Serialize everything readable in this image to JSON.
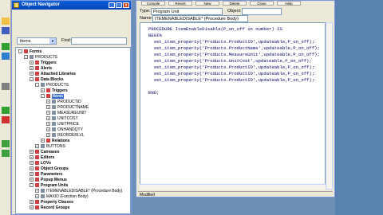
{
  "navigator": {
    "title": "Object Navigator",
    "view_select": "Items",
    "find_label": "Find:",
    "tree": [
      {
        "label": "Forms",
        "bold": true,
        "indent": 0,
        "expanded": true
      },
      {
        "label": "PRODUCTS",
        "bold": false,
        "indent": 1,
        "expanded": true
      },
      {
        "label": "Triggers",
        "bold": true,
        "indent": 2
      },
      {
        "label": "Alerts",
        "bold": true,
        "indent": 2
      },
      {
        "label": "Attached Libraries",
        "bold": true,
        "indent": 2
      },
      {
        "label": "Data Blocks",
        "bold": true,
        "indent": 2,
        "expanded": true
      },
      {
        "label": "PRODUCTS",
        "bold": false,
        "indent": 3,
        "expanded": true
      },
      {
        "label": "Triggers",
        "bold": true,
        "indent": 4
      },
      {
        "label": "Items",
        "bold": true,
        "indent": 4,
        "expanded": true,
        "selected": true
      },
      {
        "label": "PRODUCTID",
        "bold": false,
        "indent": 5
      },
      {
        "label": "PRODUCTNAME",
        "bold": false,
        "indent": 5
      },
      {
        "label": "MEASUREUNIT",
        "bold": false,
        "indent": 5
      },
      {
        "label": "UNITCOST",
        "bold": false,
        "indent": 5
      },
      {
        "label": "UNITPRICE",
        "bold": false,
        "indent": 5
      },
      {
        "label": "ONHANDQTY",
        "bold": false,
        "indent": 5
      },
      {
        "label": "REORDERLVL",
        "bold": false,
        "indent": 5
      },
      {
        "label": "Relations",
        "bold": true,
        "indent": 4
      },
      {
        "label": "BUTTONS",
        "bold": false,
        "indent": 3
      },
      {
        "label": "Canvases",
        "bold": true,
        "indent": 2
      },
      {
        "label": "Editors",
        "bold": true,
        "indent": 2
      },
      {
        "label": "LOVs",
        "bold": true,
        "indent": 2
      },
      {
        "label": "Object Groups",
        "bold": true,
        "indent": 2
      },
      {
        "label": "Parameters",
        "bold": true,
        "indent": 2
      },
      {
        "label": "Popup Menus",
        "bold": true,
        "indent": 2
      },
      {
        "label": "Program Units",
        "bold": true,
        "indent": 2,
        "expanded": true
      },
      {
        "label": "ITEMENABLEDISABLE* (Procedure Body)",
        "bold": false,
        "indent": 3
      },
      {
        "label": "MAXID (Function Body)",
        "bold": false,
        "indent": 3
      },
      {
        "label": "Property Classes",
        "bold": true,
        "indent": 2
      },
      {
        "label": "Record Groups",
        "bold": true,
        "indent": 2
      }
    ]
  },
  "editor": {
    "toolbar_buttons": [
      "Compile",
      "Revert",
      "New",
      "Delete",
      "Close",
      "Help"
    ],
    "type_label": "Type:",
    "type_value": "Program Unit",
    "object_label": "Object:",
    "name_label": "Name:",
    "name_value": "ITEMENABLEDISABLE* (Procedure Body)",
    "code_lines": [
      "PROCEDURE ItemEnableDisable(P_on_off in number) IS",
      "BEGIN",
      "  set_item_property('Products.ProductID',updateable,P_on_off);",
      "  set_item_property('Products.ProductName',updateable,P_on_off);",
      "  set_item_property('Products.MeasureUnit',updateable,P_on_off);",
      "  set_item_property('Products.UnitCost',updateable,P_on_off);",
      "  set_item_property('Products.ProductID',updateable,P_on_off);",
      "  set_item_property('Products.ProductID',updateable,P_on_off);",
      "  set_item_property('Products.ProductID',updateable,P_on_off);",
      "",
      "END;"
    ],
    "status": "Modified"
  },
  "colors": {
    "desktop": "#6b8fb5",
    "titlebar": "#0a5fd8",
    "selection": "#316ac5",
    "code_text": "#00006a"
  }
}
